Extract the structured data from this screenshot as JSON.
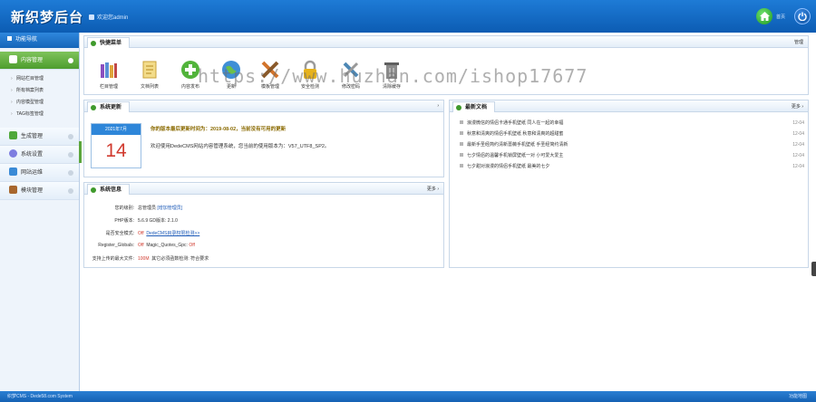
{
  "header": {
    "logo": "新织梦后台",
    "welcome": "欢迎您admin",
    "home_label": "首页"
  },
  "sidebar": {
    "title": "功能导航",
    "categories": [
      {
        "label": "内容管理",
        "active": true,
        "subs": [
          "网站栏目管理",
          "所有档案列表",
          "内容模型管理",
          "TAG标签管理"
        ]
      },
      {
        "label": "生成管理",
        "active": false
      },
      {
        "label": "系统设置",
        "active": false
      },
      {
        "label": "网站运维",
        "active": false
      },
      {
        "label": "模块管理",
        "active": false
      }
    ]
  },
  "quickmenu": {
    "title": "快捷菜单",
    "more": "管理",
    "items": [
      {
        "label": "栏目管理",
        "icon": "books-icon",
        "color": "#8a4fbf"
      },
      {
        "label": "文档列表",
        "icon": "document-icon",
        "color": "#e8c35a"
      },
      {
        "label": "内容发布",
        "icon": "add-icon",
        "color": "#52b43b"
      },
      {
        "label": "更新",
        "icon": "globe-icon",
        "color": "#3f8fd6"
      },
      {
        "label": "模板管理",
        "icon": "tools-icon",
        "color": "#d2742c"
      },
      {
        "label": "安全检测",
        "icon": "lock-icon",
        "color": "#e6b21d"
      },
      {
        "label": "修改密码",
        "icon": "wrench-icon",
        "color": "#4e88b5"
      },
      {
        "label": "清除缓存",
        "icon": "trash-icon",
        "color": "#7b7b7b"
      }
    ]
  },
  "watermark": "https://www.huzhan.com/ishop17677",
  "sysupdate": {
    "title": "系统更新",
    "month": "2021年7月",
    "day": "14",
    "line1": "你的版本最后更新时间为：2019-08-02，当前没有可用的更新",
    "line2": "欢迎使用DedeCMS网站内容管理系统，您当前的使用版本为：V57_UTF8_SP2。"
  },
  "news": {
    "title": "最新文档",
    "more": "更多",
    "items": [
      {
        "title": "浪漫微信的情侣卡通手机壁纸 同人在一起的幸福",
        "date": "12-04"
      },
      {
        "title": "秋意和清爽的情侣手机壁纸 秋意和清爽的超甜蜜",
        "date": "12-04"
      },
      {
        "title": "最新手圣经简约清新蔷薇手机壁纸 手圣经简约清新",
        "date": "12-04"
      },
      {
        "title": "七夕情侣的温馨手机锁屏壁纸一对 小可爱大爱主",
        "date": "12-04"
      },
      {
        "title": "七夕甜对浪漫的情侣手机壁纸 最美的七夕",
        "date": "12-04"
      }
    ]
  },
  "sysinfo": {
    "title": "系统信息",
    "more": "更多",
    "rows": [
      {
        "k": "您的级别:",
        "v": "总管理员",
        "link": "[增加管理员]"
      },
      {
        "k": "PHP版本:",
        "v": "5.6.9   GD版本: 2.1.0"
      },
      {
        "k": "是否安全模式:",
        "v": "Off",
        "link": "DedeCMS目录权限检测>>"
      },
      {
        "k": "Register_Globals:",
        "v": "Off",
        "v2": "Magic_Quotes_Gpc:",
        "v3": "Off"
      },
      {
        "k": "支持上传的最大文件:",
        "v": "100M",
        "v2": "其它必须函数检测: 符合要求"
      }
    ]
  },
  "footer": {
    "left": "织梦CMS - Dede58.com System",
    "right": "功能地图"
  },
  "colors": {
    "header": "#1a70c9",
    "accent_green": "#4d9d2e",
    "red": "#d13b2f",
    "link_blue": "#1e5bb8"
  }
}
